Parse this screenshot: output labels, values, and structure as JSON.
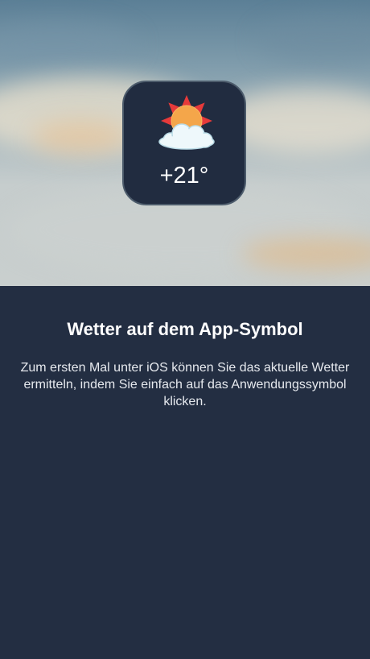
{
  "app_icon": {
    "temperature": "+21°",
    "weather_icon": "sun-behind-cloud-icon"
  },
  "onboarding": {
    "title": "Wetter auf dem App-Symbol",
    "description": "Zum ersten Mal unter iOS können Sie das aktuelle Wetter ermitteln, indem Sie einfach auf das Anwendungssymbol klicken."
  },
  "colors": {
    "panel_background": "#232e42",
    "icon_background": "#212c40",
    "sun": "#f4a64a",
    "sun_rays": "#e63a3a",
    "cloud": "#eef8fb"
  }
}
